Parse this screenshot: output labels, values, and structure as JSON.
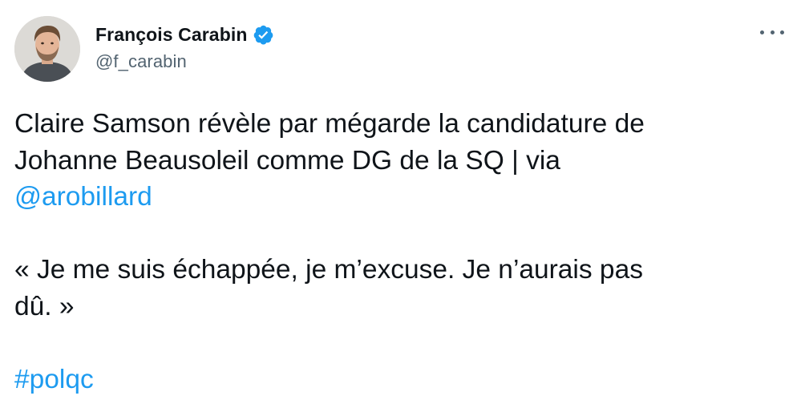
{
  "author": {
    "display_name": "François Carabin",
    "handle": "@f_carabin",
    "verified": true
  },
  "tweet": {
    "line1": "Claire Samson révèle par mégarde la candidature de",
    "line2": "Johanne Beausoleil comme DG de la SQ | via",
    "mention": "@arobillard",
    "quote_line1": "« Je me suis échappée, je m’excuse. Je n’aurais pas",
    "quote_line2": "dû. »",
    "hashtag": "#polqc"
  },
  "icons": {
    "verified": "verified-badge-icon",
    "more": "more-options-icon"
  },
  "colors": {
    "accent": "#1d9bf0",
    "text": "#0f1419",
    "secondary": "#536471"
  }
}
